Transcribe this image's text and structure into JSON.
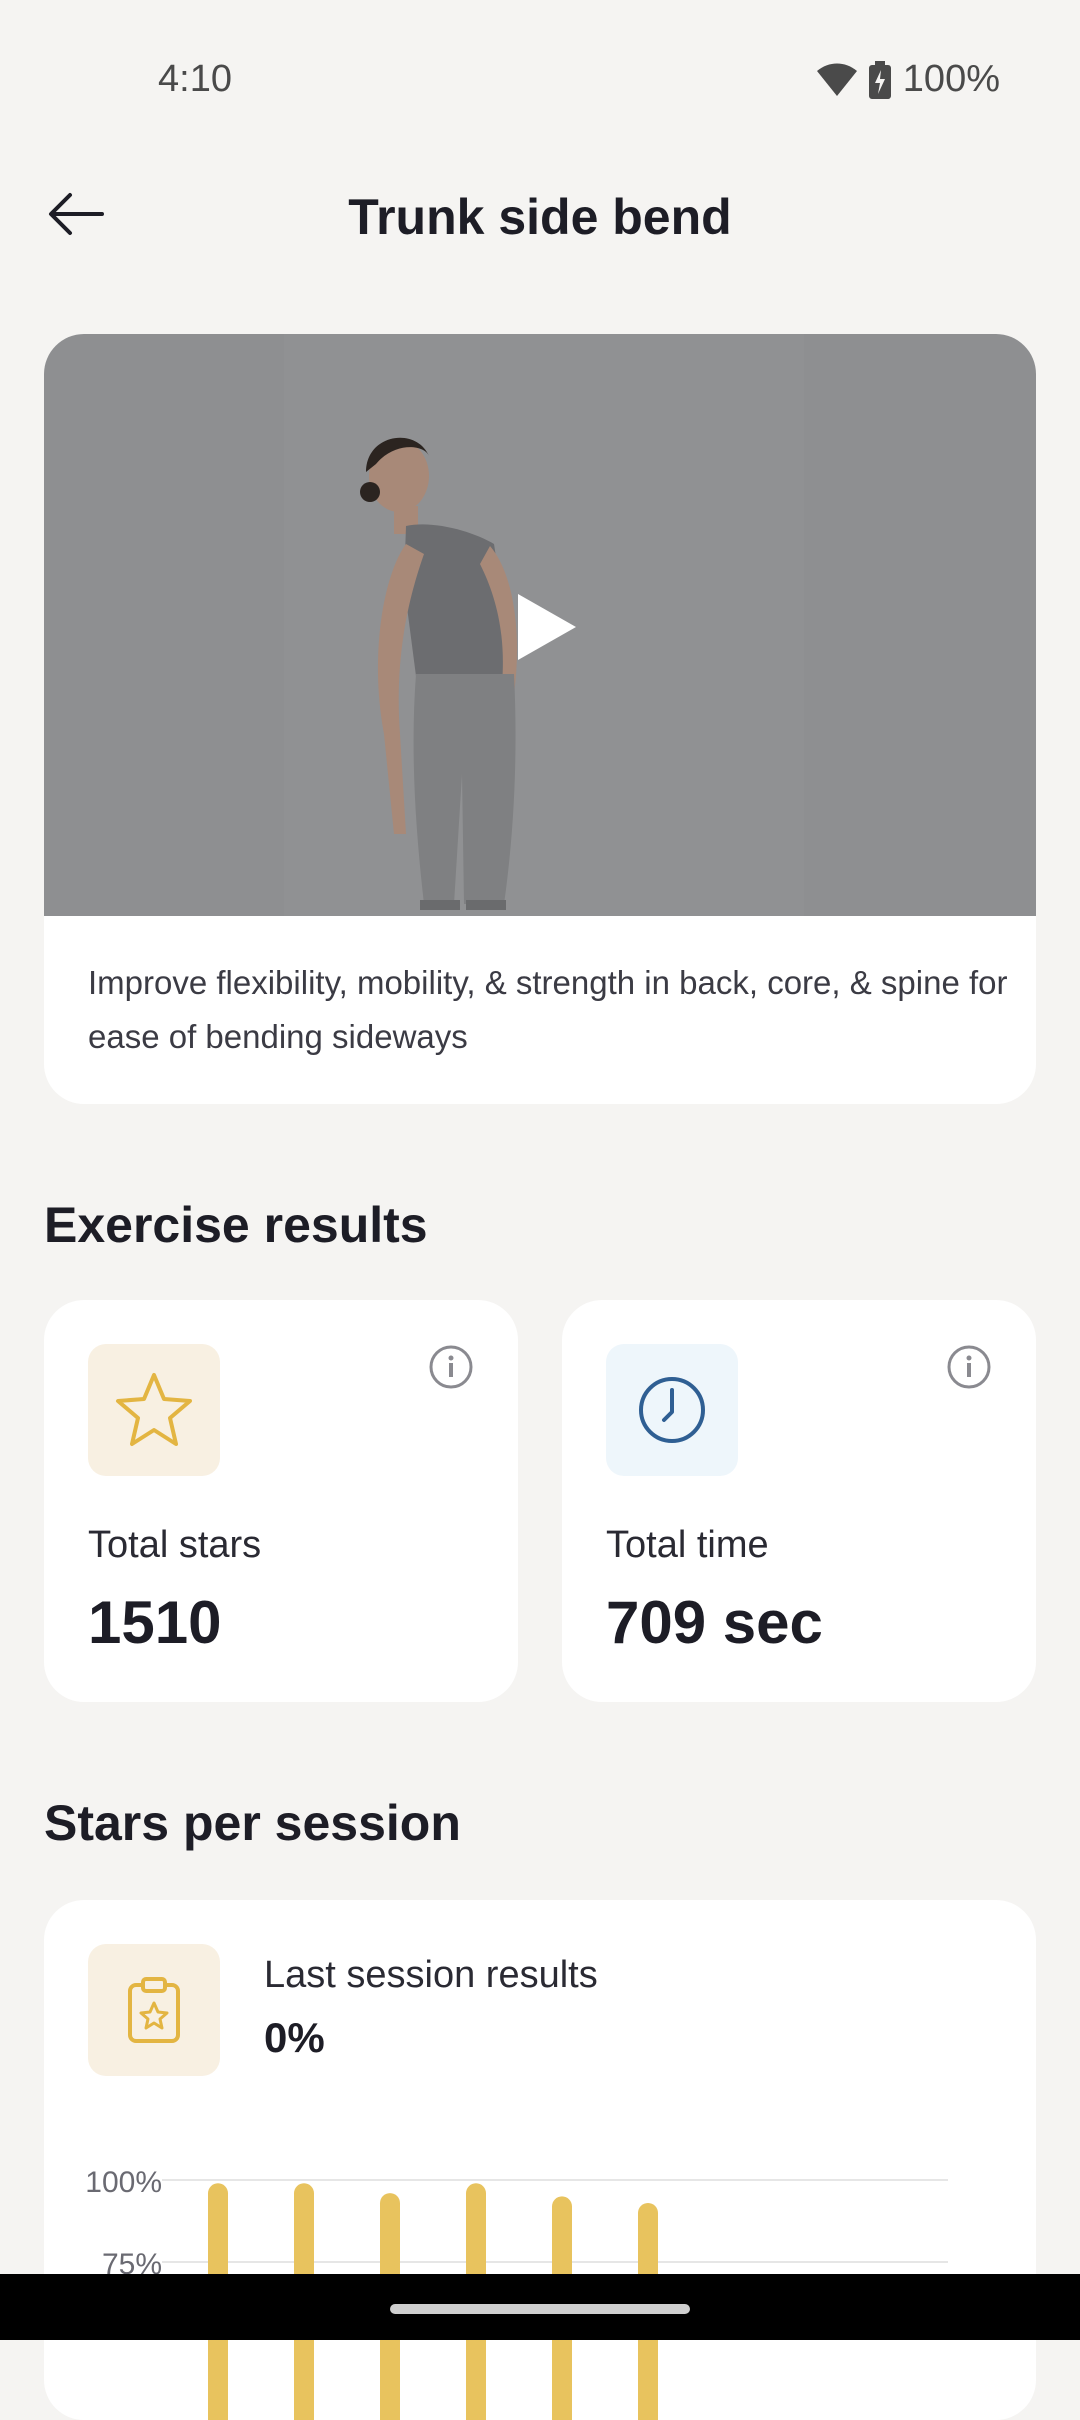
{
  "status": {
    "time": "4:10",
    "battery": "100%",
    "icons": [
      "wifi-icon",
      "battery-charging-icon"
    ]
  },
  "header": {
    "title": "Trunk side bend",
    "back_icon": "arrow-left-icon"
  },
  "video": {
    "description": "Improve flexibility, mobility, & strength in back, core, & spine for ease of bending sideways",
    "play_icon": "play-icon"
  },
  "results": {
    "title": "Exercise results",
    "cards": [
      {
        "label": "Total stars",
        "value": "1510",
        "icon": "star-icon",
        "color": "#e3b542"
      },
      {
        "label": "Total time",
        "value": "709 sec",
        "icon": "clock-icon",
        "color": "#2f5f93"
      }
    ]
  },
  "session": {
    "title": "Stars per session",
    "last_label": "Last session results",
    "last_value": "0%",
    "icon": "clipboard-star-icon"
  },
  "chart_data": {
    "type": "bar",
    "y_tick_labels": [
      "100%",
      "75%"
    ],
    "values": [
      99,
      99,
      96,
      99,
      95,
      93
    ],
    "ylim": [
      0,
      100
    ],
    "grid": true,
    "bar_color": "#e8c35e"
  },
  "colors": {
    "background": "#f5f4f2",
    "star_accent": "#e3b542",
    "clock_accent": "#2f5f93"
  }
}
